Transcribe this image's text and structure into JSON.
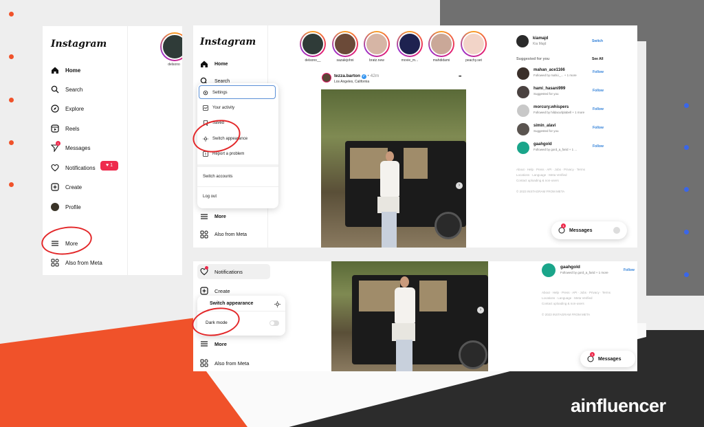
{
  "app": {
    "logo": "Instagram"
  },
  "colors": {
    "accent_red": "#e3282a",
    "brand_orange": "#f0522a",
    "dot_blue": "#3a66e8",
    "follow_blue": "#2f7fd8"
  },
  "left_panel": {
    "nav": [
      {
        "label": "Home",
        "icon": "home-icon"
      },
      {
        "label": "Search",
        "icon": "search-icon"
      },
      {
        "label": "Explore",
        "icon": "compass-icon"
      },
      {
        "label": "Reels",
        "icon": "reels-icon"
      },
      {
        "label": "Messages",
        "icon": "messenger-icon"
      },
      {
        "label": "Notifications",
        "icon": "heart-icon"
      },
      {
        "label": "Create",
        "icon": "plus-square-icon"
      },
      {
        "label": "Profile",
        "icon": "avatar-icon"
      },
      {
        "label": "More",
        "icon": "hamburger-icon"
      },
      {
        "label": "Also from Meta",
        "icon": "meta-icon"
      }
    ],
    "messages_badge": "1",
    "notifications_badge": "1",
    "story_name": "delsono"
  },
  "middle_panel": {
    "nav": {
      "home": "Home",
      "search": "Search",
      "more": "More",
      "meta": "Also from Meta"
    },
    "menu": [
      {
        "label": "Settings",
        "icon": "gear-icon"
      },
      {
        "label": "Your activity",
        "icon": "activity-icon"
      },
      {
        "label": "Saved",
        "icon": "bookmark-icon"
      },
      {
        "label": "Switch appearance",
        "icon": "sun-icon"
      },
      {
        "label": "Report a problem",
        "icon": "warning-icon"
      },
      {
        "label": "Switch accounts",
        "icon": ""
      },
      {
        "label": "Log out",
        "icon": ""
      }
    ],
    "stories": [
      "delsono__",
      "sazalejohni",
      "bratz.new",
      "movie_m...",
      "mahdidami",
      "peachy.set"
    ],
    "post": {
      "user": "tezza.barton",
      "verified": "✓",
      "time": "• 42m",
      "location": "Los Angeles, California",
      "more": "•••"
    },
    "sidebar": {
      "me": {
        "user": "kiamajd",
        "name": "Kia Majd",
        "action": "Switch"
      },
      "suggested_title": "Suggested for you",
      "see_all": "See All",
      "suggestions": [
        {
          "user": "mahan_ace1166",
          "sub": "Followed by mahi.i_... + 1 more",
          "action": "Follow"
        },
        {
          "user": "hami_hasani999",
          "sub": "Suggested for you",
          "action": "Follow"
        },
        {
          "user": "morcury.whispers",
          "sub": "Followed by hildacurlplabell + 1 more",
          "action": "Follow"
        },
        {
          "user": "simin_alavi",
          "sub": "Suggested for you",
          "action": "Follow"
        },
        {
          "user": "gaahgold",
          "sub": "Followed by gord_a_farid + 1 ...",
          "action": "Follow"
        }
      ],
      "footer": [
        "About · Help · Press · API · Jobs · Privacy · Terms",
        "Locations · Language · Meta Verified",
        "Contact uploading & non-users",
        "© 2023 INSTAGRAM FROM META"
      ]
    },
    "messages_pill": {
      "label": "Messages",
      "badge": "1"
    }
  },
  "bottom_panel": {
    "nav": {
      "notifications": "Notifications",
      "create": "Create",
      "more": "More",
      "meta": "Also from Meta"
    },
    "appearance": {
      "title": "Switch appearance",
      "dark_mode": "Dark mode"
    },
    "sidebar": {
      "user": "gaahgold",
      "sub": "Followed by gord_a_farid + 1 more",
      "action": "Follow",
      "footer": [
        "About · Help · Press · API · Jobs · Privacy · Terms",
        "Locations · Language · Meta Verified",
        "Contact uploading & non-users",
        "© 2023 INSTAGRAM FROM META"
      ]
    },
    "messages_pill": {
      "label": "Messages",
      "badge": "1"
    }
  },
  "brand": "ainfluencer"
}
